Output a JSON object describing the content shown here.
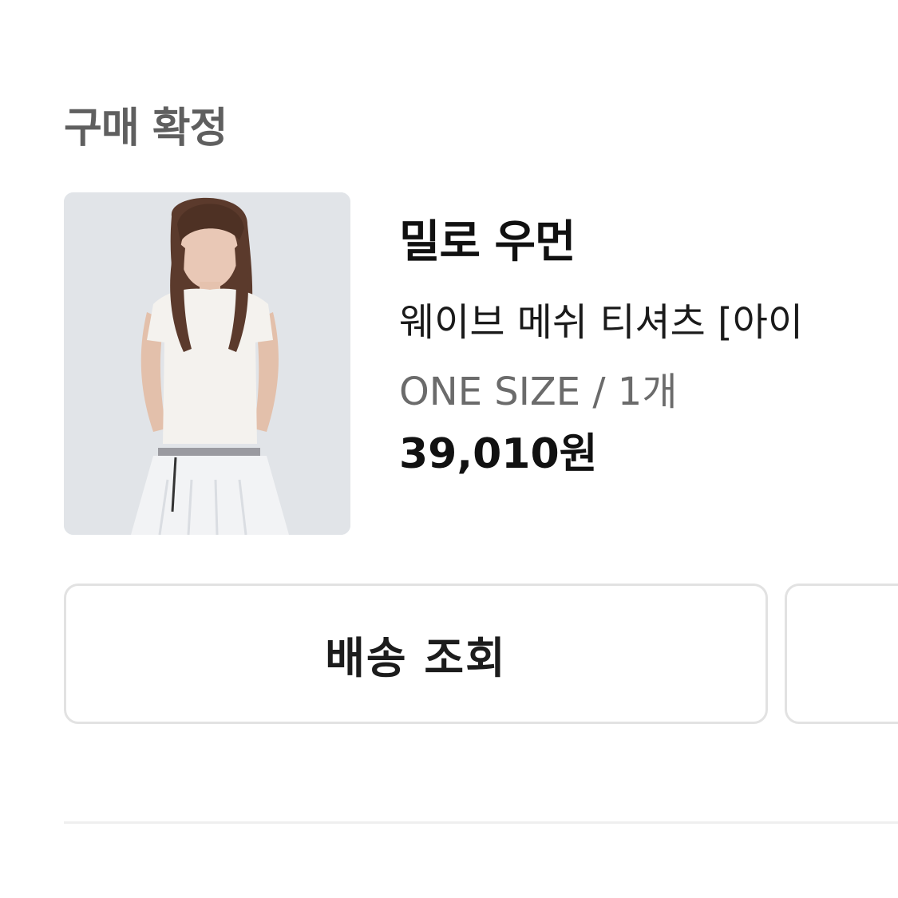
{
  "order": {
    "status_title": "구매 확정"
  },
  "product": {
    "brand": "밀로 우먼",
    "name": "웨이브 메쉬 티셔츠 [아이",
    "option": "ONE SIZE / 1개",
    "price": "39,010원",
    "image_icon": "product-photo"
  },
  "actions": {
    "delivery_label": "배송 조회",
    "secondary_label": ""
  },
  "colors": {
    "title_gray": "#5f5f5f",
    "option_gray": "#6b6b6b",
    "text_dark": "#111111",
    "button_border": "#e2e2e2",
    "divider": "#efefef"
  }
}
